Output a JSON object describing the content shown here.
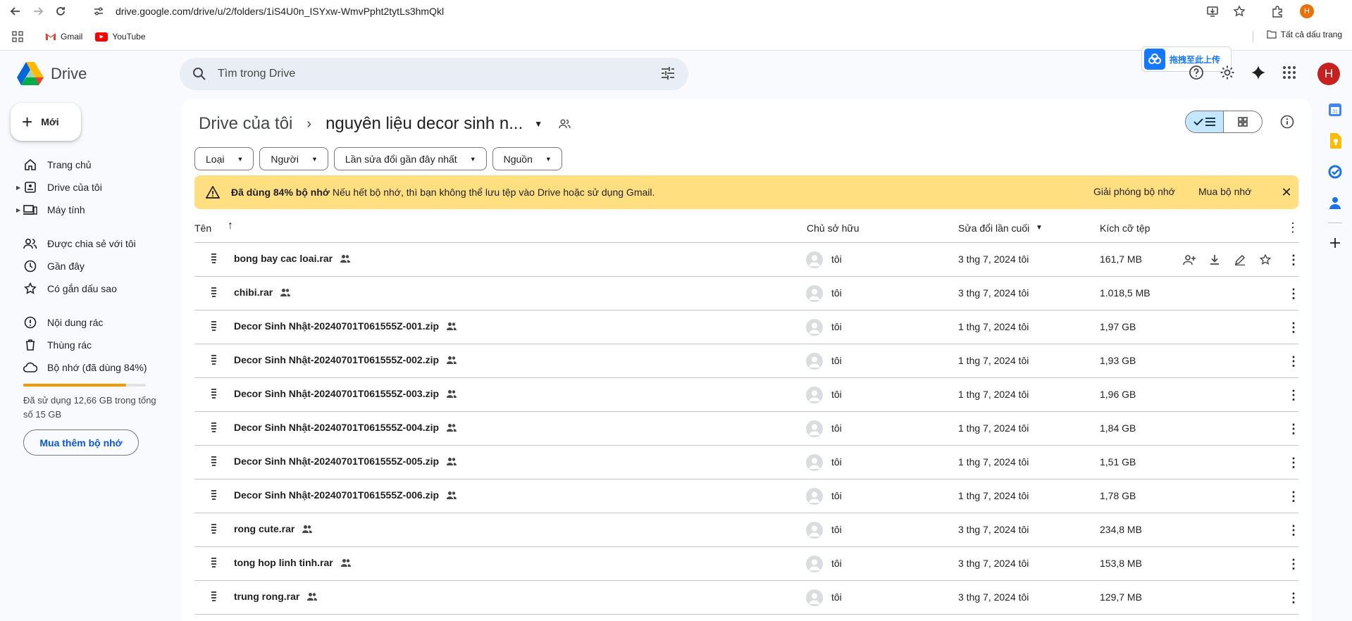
{
  "browser": {
    "url": "drive.google.com/drive/u/2/folders/1iS4U0n_ISYxw-WmvPpht2tytLs3hmQkl",
    "profile_initial": "H",
    "bookmarks": [
      {
        "label": "Gmail",
        "icon": "gmail-icon"
      },
      {
        "label": "YouTube",
        "icon": "youtube-icon"
      }
    ],
    "all_bookmarks_label": "Tất cả dấu trang"
  },
  "header": {
    "app_name": "Drive",
    "search_placeholder": "Tìm trong Drive",
    "baidu_label": "拖拽至此上传",
    "avatar_initial": "H"
  },
  "sidebar": {
    "new_label": "Mới",
    "items": [
      {
        "label": "Trang chủ",
        "icon": "home-icon",
        "expandable": false
      },
      {
        "label": "Drive của tôi",
        "icon": "my-drive-icon",
        "expandable": true
      },
      {
        "label": "Máy tính",
        "icon": "computer-icon",
        "expandable": true
      },
      {
        "label": "Được chia sẻ với tôi",
        "icon": "shared-icon",
        "expandable": false
      },
      {
        "label": "Gần đây",
        "icon": "clock-icon",
        "expandable": false
      },
      {
        "label": "Có gắn dấu sao",
        "icon": "star-icon",
        "expandable": false
      },
      {
        "label": "Nội dung rác",
        "icon": "spam-icon",
        "expandable": false
      },
      {
        "label": "Thùng rác",
        "icon": "trash-icon",
        "expandable": false
      },
      {
        "label": "Bộ nhớ (đã dùng 84%)",
        "icon": "cloud-icon",
        "expandable": false
      }
    ],
    "storage_used_fraction": 0.84,
    "storage_text": "Đã sử dụng 12,66 GB trong tổng số 15 GB",
    "buy_storage_label": "Mua thêm bộ nhớ"
  },
  "main": {
    "breadcrumb_root": "Drive của tôi",
    "breadcrumb_current": "nguyên liệu decor sinh n...",
    "filters": [
      "Loại",
      "Người",
      "Lần sửa đổi gần đây nhất",
      "Nguồn"
    ],
    "banner": {
      "strong": "Đã dùng 84% bộ nhớ",
      "message": "Nếu hết bộ nhớ, thì bạn không thể lưu tệp vào Drive hoặc sử dụng Gmail.",
      "action1": "Giải phóng bộ nhớ",
      "action2": "Mua bộ nhớ",
      "color": "#ffdf80"
    },
    "columns": {
      "name": "Tên",
      "owner": "Chủ sở hữu",
      "modified": "Sửa đổi lần cuối",
      "size": "Kích cỡ tệp"
    },
    "files": [
      {
        "name": "bong bay cac loai.rar",
        "owner": "tôi",
        "modified": "3 thg 7, 2024 tôi",
        "size": "161,7 MB",
        "hovered": true
      },
      {
        "name": "chibi.rar",
        "owner": "tôi",
        "modified": "3 thg 7, 2024 tôi",
        "size": "1.018,5 MB"
      },
      {
        "name": "Decor Sinh Nhật-20240701T061555Z-001.zip",
        "owner": "tôi",
        "modified": "1 thg 7, 2024 tôi",
        "size": "1,97 GB"
      },
      {
        "name": "Decor Sinh Nhật-20240701T061555Z-002.zip",
        "owner": "tôi",
        "modified": "1 thg 7, 2024 tôi",
        "size": "1,93 GB"
      },
      {
        "name": "Decor Sinh Nhật-20240701T061555Z-003.zip",
        "owner": "tôi",
        "modified": "1 thg 7, 2024 tôi",
        "size": "1,96 GB"
      },
      {
        "name": "Decor Sinh Nhật-20240701T061555Z-004.zip",
        "owner": "tôi",
        "modified": "1 thg 7, 2024 tôi",
        "size": "1,84 GB"
      },
      {
        "name": "Decor Sinh Nhật-20240701T061555Z-005.zip",
        "owner": "tôi",
        "modified": "1 thg 7, 2024 tôi",
        "size": "1,51 GB"
      },
      {
        "name": "Decor Sinh Nhật-20240701T061555Z-006.zip",
        "owner": "tôi",
        "modified": "1 thg 7, 2024 tôi",
        "size": "1,78 GB"
      },
      {
        "name": "rong cute.rar",
        "owner": "tôi",
        "modified": "3 thg 7, 2024 tôi",
        "size": "234,8 MB"
      },
      {
        "name": "tong hop linh tinh.rar",
        "owner": "tôi",
        "modified": "3 thg 7, 2024 tôi",
        "size": "153,8 MB"
      },
      {
        "name": "trung rong.rar",
        "owner": "tôi",
        "modified": "3 thg 7, 2024 tôi",
        "size": "129,7 MB"
      }
    ]
  },
  "side_panel": {
    "apps": [
      "calendar-icon",
      "keep-icon",
      "tasks-icon",
      "contacts-icon"
    ]
  }
}
